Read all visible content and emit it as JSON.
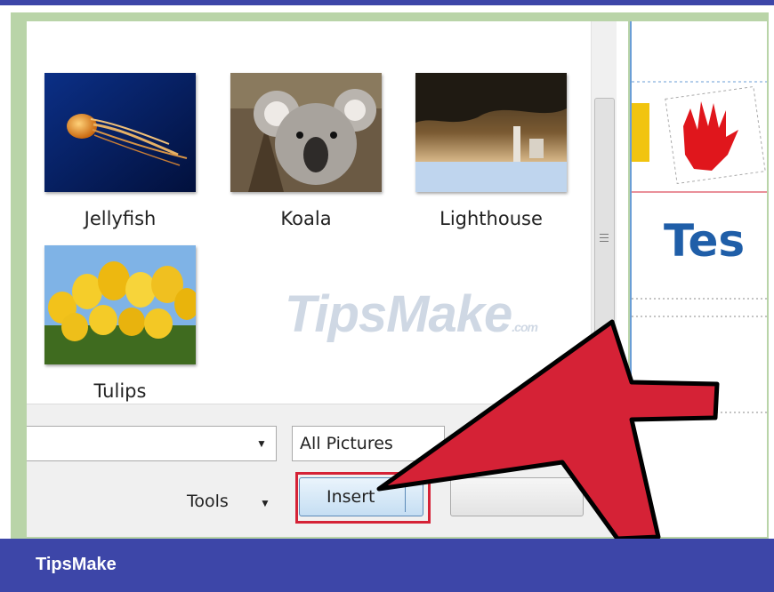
{
  "gallery": {
    "items": [
      {
        "label": "Jellyfish"
      },
      {
        "label": "Koala"
      },
      {
        "label": "Lighthouse"
      },
      {
        "label": "Tulips"
      }
    ]
  },
  "watermark": {
    "text": "TipsMake",
    "suffix": ".com"
  },
  "file_bar": {
    "filename_value": "",
    "filter_value": "All Pictures"
  },
  "actions": {
    "tools_label": "Tools",
    "insert_label": "Insert",
    "cancel_label": ""
  },
  "document": {
    "heading_fragment": "Tes"
  },
  "banner": {
    "text": "TipsMake"
  },
  "colors": {
    "banner": "#3d46a8",
    "highlight": "#d52236",
    "arrow": "#d52236",
    "frame": "#b9d4a8"
  },
  "icons": [
    "dropdown-arrow-icon",
    "scroll-grip-icon",
    "scroll-down-icon",
    "pointer-arrow-icon"
  ]
}
